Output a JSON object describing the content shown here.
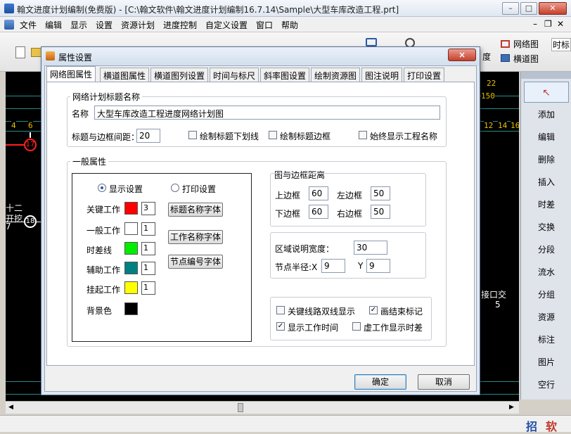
{
  "window": {
    "title": "翰文进度计划编制(免费版) - [C:\\翰文软件\\翰文进度计划编制16.7.14\\Sample\\大型车库改造工程.prt]"
  },
  "menubar": {
    "items": [
      "文件",
      "编辑",
      "显示",
      "设置",
      "资源计划",
      "进度控制",
      "自定义设置",
      "窗口",
      "帮助"
    ]
  },
  "toolbar": {
    "network_label": "网络图",
    "timescale_label": "时标",
    "grid_label": "横道图",
    "progress_partial": "度"
  },
  "chart": {
    "ticks_row1": [
      "22"
    ],
    "ticks_row2_left": [
      "4",
      "6"
    ],
    "ticks_row2_right": [
      "12",
      "14",
      "16"
    ],
    "ticks_mid": [
      "150"
    ],
    "node_17": "17",
    "node_18": "18",
    "left_text_1": "十二",
    "left_text_2": "开挖",
    "left_text_3": "7",
    "right_text": "接口交",
    "right_num": "5"
  },
  "right_panel": {
    "items": [
      "添加",
      "编辑",
      "删除",
      "插入",
      "时差",
      "交换",
      "分段",
      "流水",
      "分组",
      "资源",
      "标注",
      "图片",
      "空行"
    ],
    "ime_1": "招",
    "ime_2": "软"
  },
  "dialog": {
    "title": "属性设置",
    "close": "×",
    "tabs": [
      "网络图属性",
      "横道图属性",
      "横道图列设置",
      "时间与标尺",
      "斜率图设置",
      "绘制资源图",
      "图注说明",
      "打印设置"
    ],
    "title_group": {
      "legend": "网络计划标题名称",
      "name_label": "名称",
      "name_value": "大型车库改造工程进度网络计划图",
      "spacing_label": "标题与边框间距：",
      "spacing_value": "20",
      "underline_label": "绘制标题下划线",
      "border_label": "绘制标题边框",
      "always_show_label": "始终显示工程名称"
    },
    "general": {
      "legend": "一般属性",
      "display_radio": "显示设置",
      "print_radio": "打印设置",
      "rows": [
        {
          "label": "关键工作",
          "color": "#ff0000",
          "width": "3"
        },
        {
          "label": "一般工作",
          "color": "#ffffff",
          "width": "1"
        },
        {
          "label": "时差线",
          "color": "#00ee00",
          "width": "1"
        },
        {
          "label": "辅助工作",
          "color": "#008080",
          "width": "1"
        },
        {
          "label": "挂起工作",
          "color": "#ffff00",
          "width": "1"
        },
        {
          "label": "背景色",
          "color": "#000000",
          "width": ""
        }
      ],
      "font_buttons": [
        "标题名称字体",
        "工作名称字体",
        "节点编号字体"
      ]
    },
    "margins": {
      "legend": "图与边框距离",
      "top_label": "上边框",
      "top_value": "60",
      "left_label": "左边框",
      "left_value": "50",
      "bottom_label": "下边框",
      "bottom_value": "60",
      "right_label": "右边框",
      "right_value": "50"
    },
    "region": {
      "width_label": "区域说明宽度：",
      "width_value": "30",
      "radius_label": "节点半径:X",
      "radius_x": "9",
      "y_label": "Y",
      "radius_y": "9"
    },
    "options": {
      "double_line": "关键线路双线显示",
      "end_mark": "画结束标记",
      "show_time": "显示工作时间",
      "dummy_float": "虚工作显示时差"
    },
    "ok": "确定",
    "cancel": "取消"
  }
}
